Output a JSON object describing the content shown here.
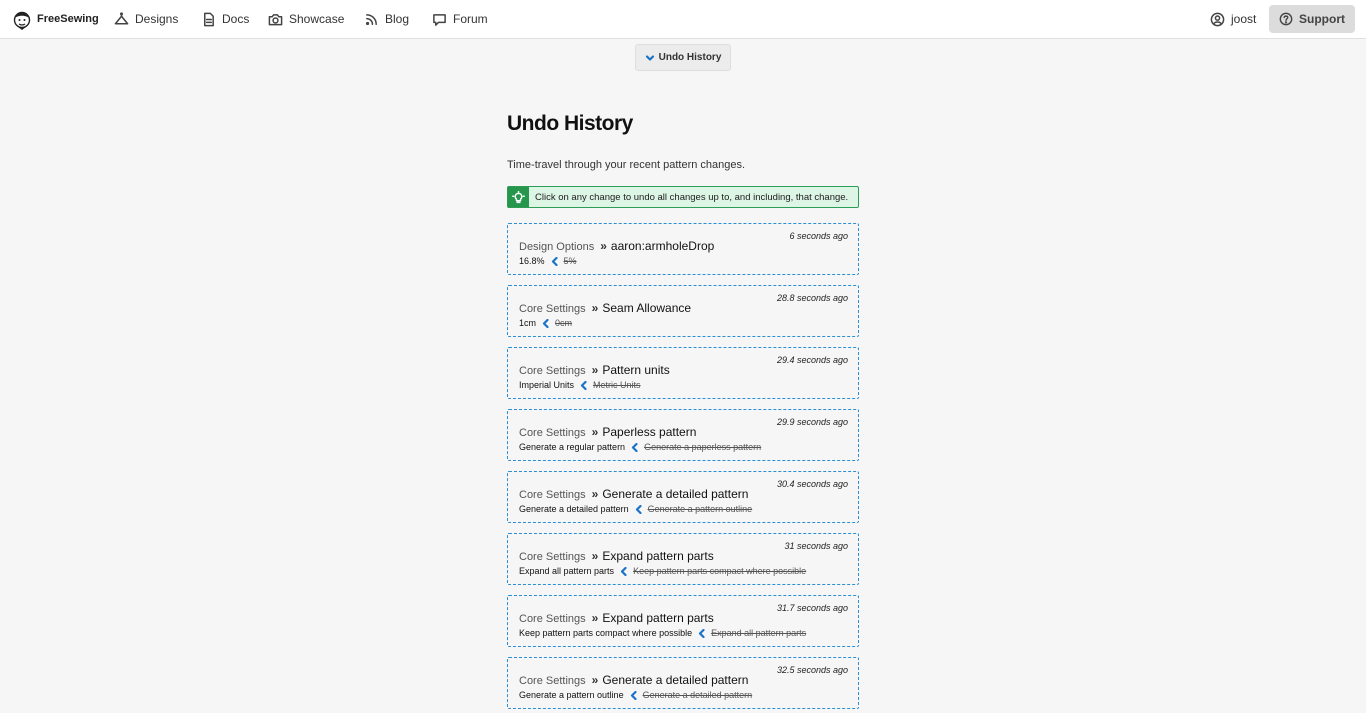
{
  "header": {
    "brand": "FreeSewing",
    "nav": [
      {
        "label": "Designs",
        "icon": "designs-icon"
      },
      {
        "label": "Docs",
        "icon": "docs-icon"
      },
      {
        "label": "Showcase",
        "icon": "camera-icon"
      },
      {
        "label": "Blog",
        "icon": "rss-icon"
      },
      {
        "label": "Forum",
        "icon": "chat-icon"
      }
    ],
    "user": "joost",
    "support": "Support"
  },
  "toggle": {
    "label": "Undo History"
  },
  "main": {
    "title": "Undo History",
    "intro": "Time-travel through your recent pattern changes.",
    "tip": "Click on any change to undo all changes up to, and including, that change."
  },
  "history": [
    {
      "category": "Design Options",
      "field": "aaron:armholeDrop",
      "new": "16.8%",
      "old": "5%",
      "ago": "6 seconds ago"
    },
    {
      "category": "Core Settings",
      "field": "Seam Allowance",
      "new": "1cm",
      "old": "0cm",
      "ago": "28.8 seconds ago"
    },
    {
      "category": "Core Settings",
      "field": "Pattern units",
      "new": "Imperial Units",
      "old": "Metric Units",
      "ago": "29.4 seconds ago"
    },
    {
      "category": "Core Settings",
      "field": "Paperless pattern",
      "new": "Generate a regular pattern",
      "old": "Generate a paperless pattern",
      "ago": "29.9 seconds ago"
    },
    {
      "category": "Core Settings",
      "field": "Generate a detailed pattern",
      "new": "Generate a detailed pattern",
      "old": "Generate a pattern outline",
      "ago": "30.4 seconds ago"
    },
    {
      "category": "Core Settings",
      "field": "Expand pattern parts",
      "new": "Expand all pattern parts",
      "old": "Keep pattern parts compact where possible",
      "ago": "31 seconds ago"
    },
    {
      "category": "Core Settings",
      "field": "Expand pattern parts",
      "new": "Keep pattern parts compact where possible",
      "old": "Expand all pattern parts",
      "ago": "31.7 seconds ago"
    },
    {
      "category": "Core Settings",
      "field": "Generate a detailed pattern",
      "new": "Generate a pattern outline",
      "old": "Generate a detailed pattern",
      "ago": "32.5 seconds ago"
    }
  ],
  "colors": {
    "accent": "#1a73c8",
    "tip_bg": "#dcf5e4",
    "tip_icon": "#26964c",
    "card_border": "#2a8ed6"
  }
}
